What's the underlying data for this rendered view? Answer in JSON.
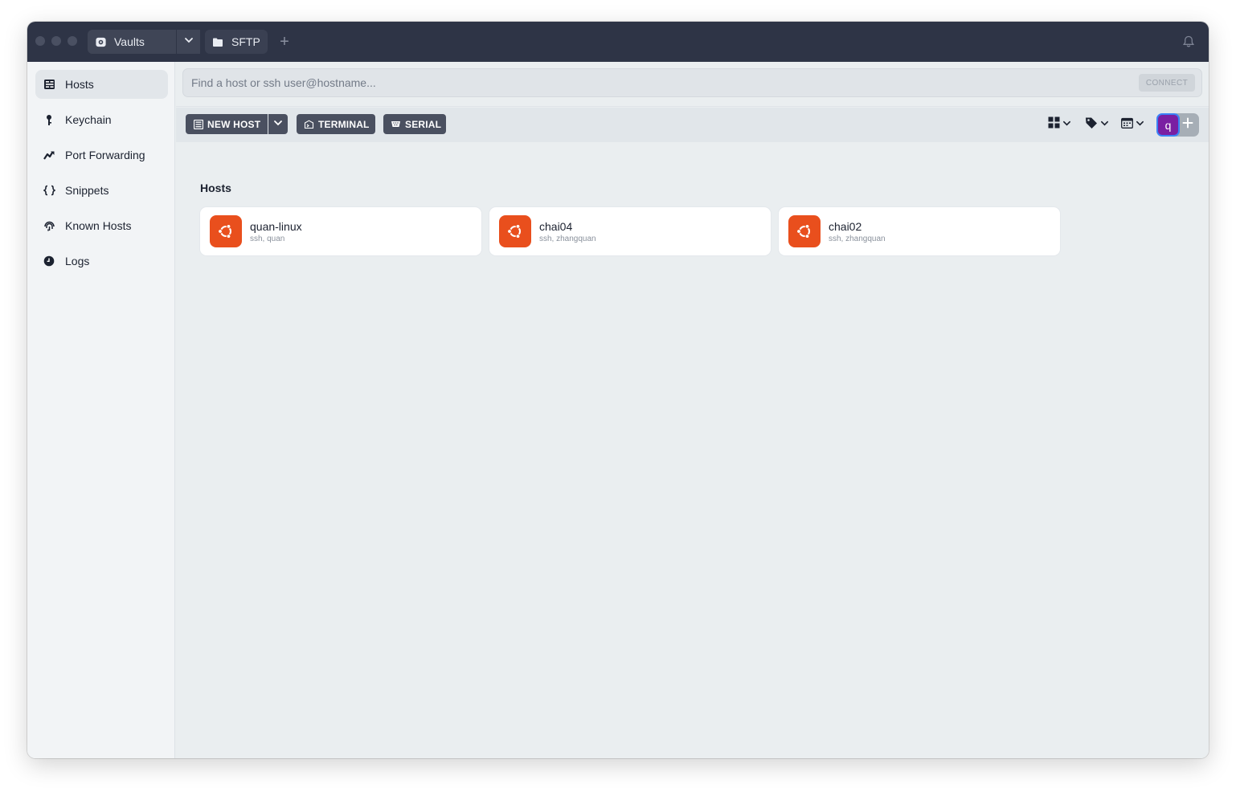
{
  "titlebar": {
    "vaults_label": "Vaults",
    "sftp_label": "SFTP",
    "new_tab_label": "+"
  },
  "sidebar": {
    "items": [
      {
        "label": "Hosts",
        "icon": "hosts-icon",
        "active": true
      },
      {
        "label": "Keychain",
        "icon": "key-icon",
        "active": false
      },
      {
        "label": "Port Forwarding",
        "icon": "port-forward-icon",
        "active": false
      },
      {
        "label": "Snippets",
        "icon": "braces-icon",
        "active": false
      },
      {
        "label": "Known Hosts",
        "icon": "fingerprint-icon",
        "active": false
      },
      {
        "label": "Logs",
        "icon": "clock-icon",
        "active": false
      }
    ]
  },
  "search": {
    "placeholder": "Find a host or ssh user@hostname...",
    "value": "",
    "connect_label": "CONNECT"
  },
  "toolbar": {
    "new_host_label": "NEW HOST",
    "terminal_label": "TERMINAL",
    "serial_label": "SERIAL",
    "avatar_letter": "q"
  },
  "hosts_section": {
    "title": "Hosts",
    "hosts": [
      {
        "name": "quan-linux",
        "details": "ssh, quan",
        "os_icon": "ubuntu-icon"
      },
      {
        "name": "chai04",
        "details": "ssh, zhangquan",
        "os_icon": "ubuntu-icon"
      },
      {
        "name": "chai02",
        "details": "ssh, zhangquan",
        "os_icon": "ubuntu-icon"
      }
    ]
  },
  "colors": {
    "titlebar_bg": "#2e3446",
    "ubuntu_orange": "#e94f1d",
    "button_dark": "#4a5060",
    "avatar_bg": "#7a1fa2",
    "avatar_ring": "#3b82f6"
  }
}
